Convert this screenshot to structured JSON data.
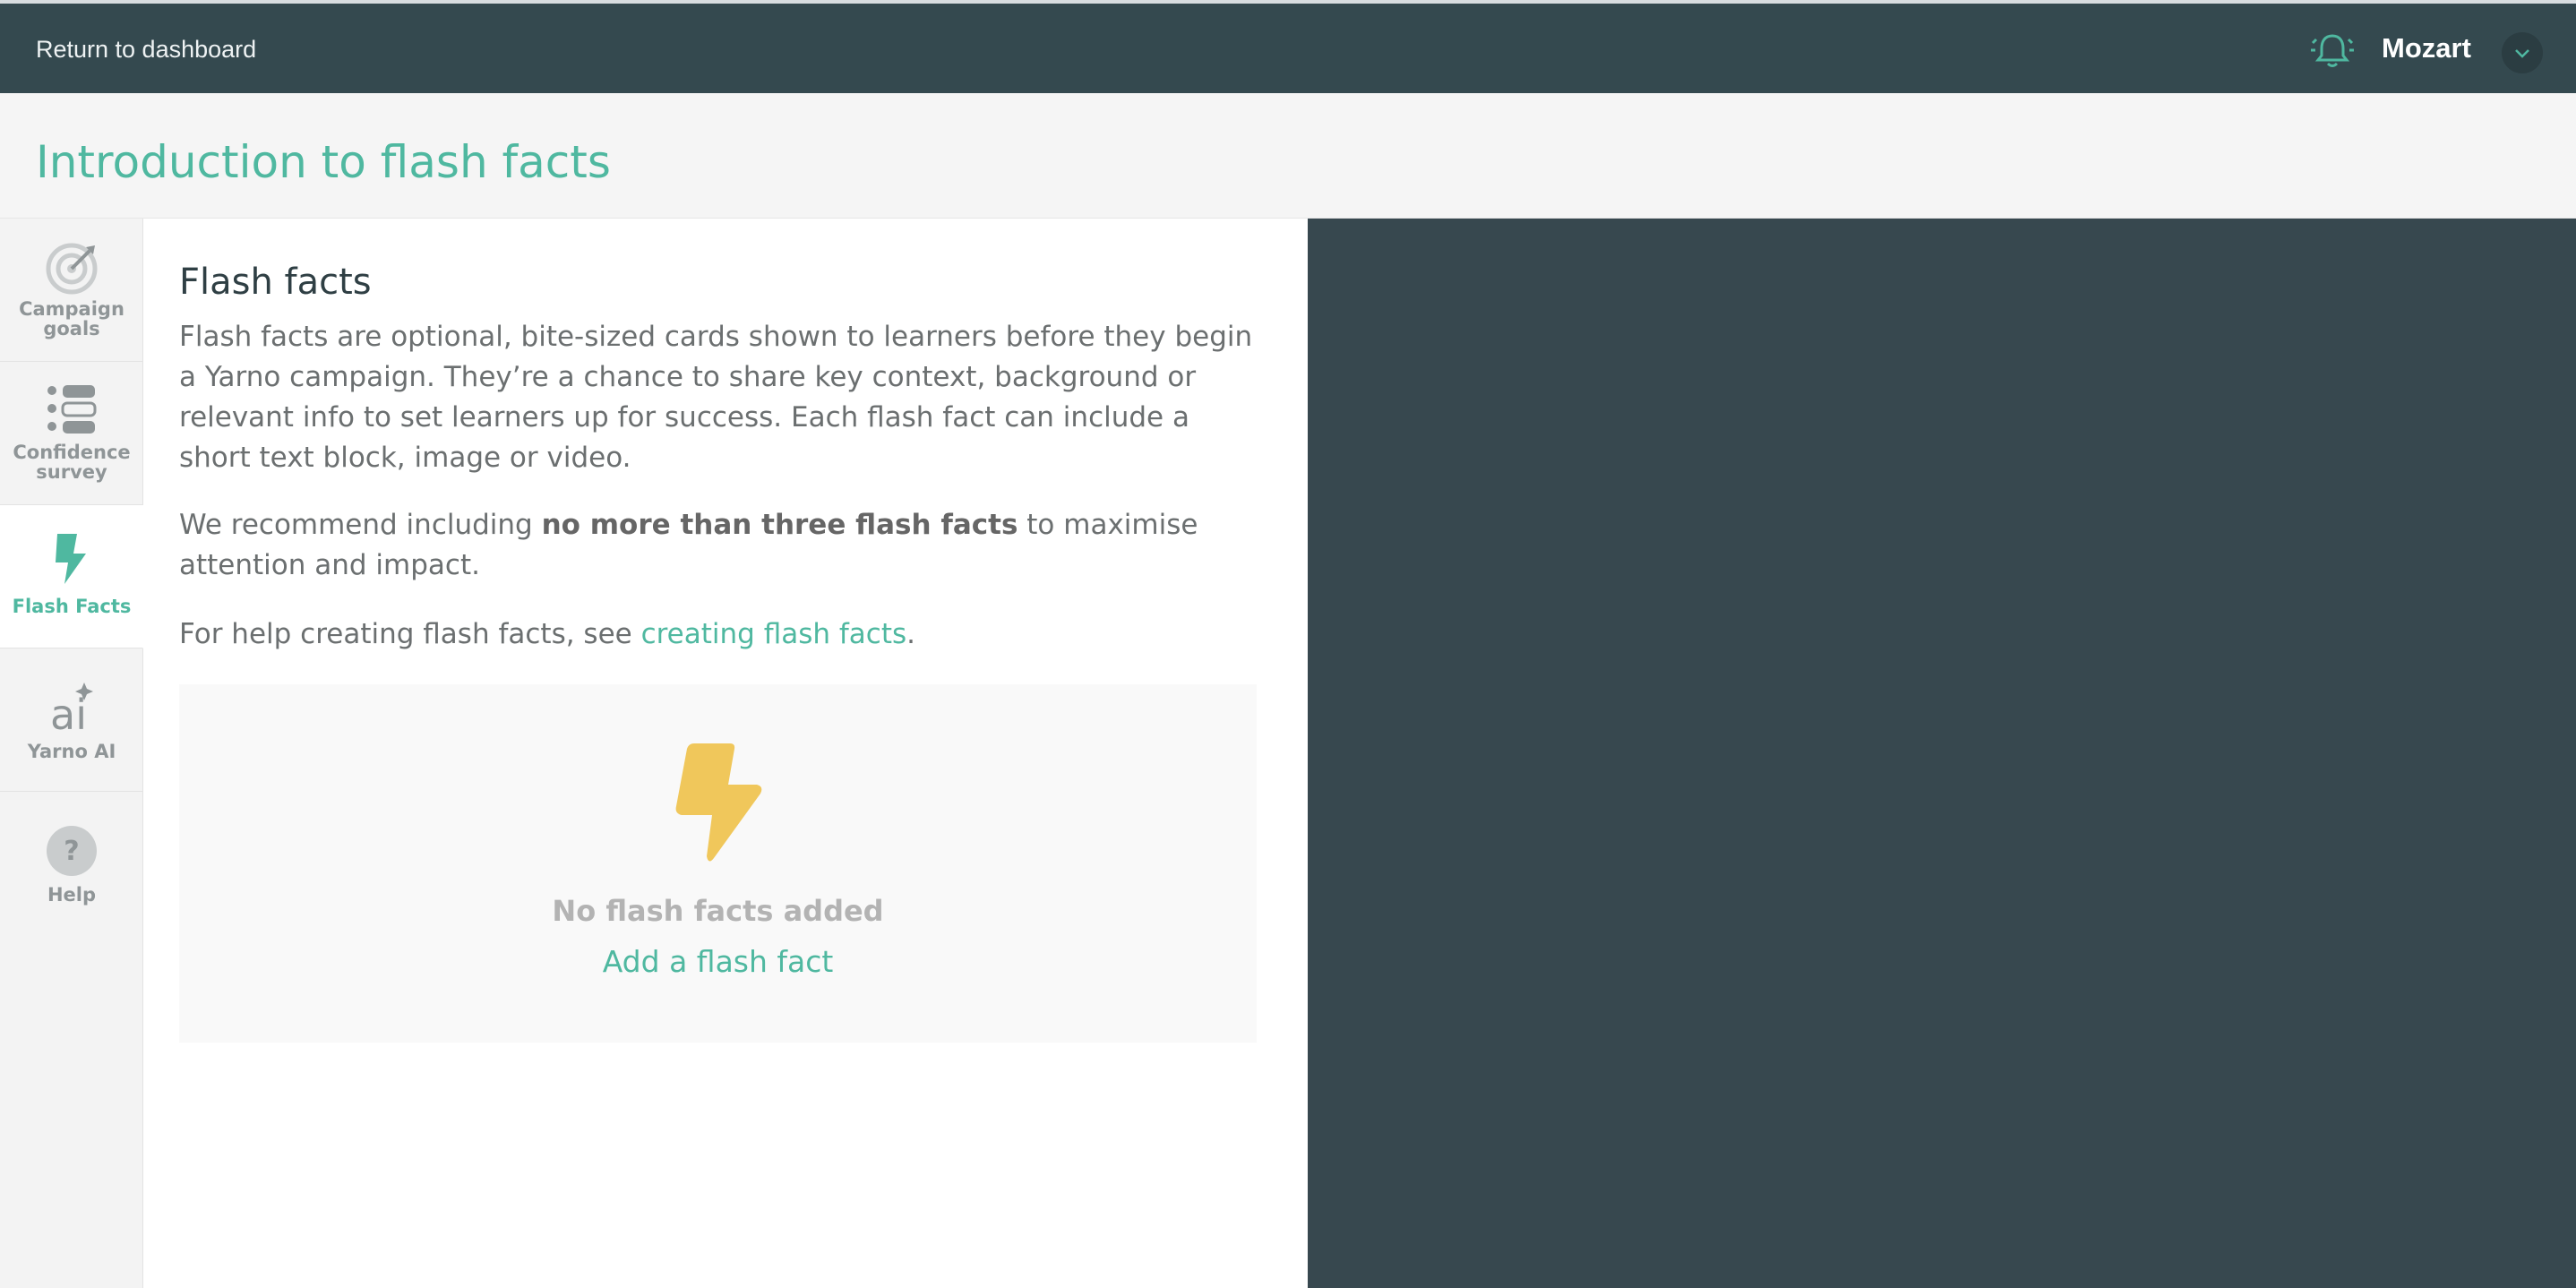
{
  "topbar": {
    "back_label": "Return to dashboard",
    "username": "Mozart",
    "bell_icon": "bell-icon",
    "caret_icon": "chevron-down-icon"
  },
  "page": {
    "title": "Introduction to flash facts"
  },
  "sidebar": {
    "items": [
      {
        "label_line1": "Campaign",
        "label_line2": "goals",
        "icon": "target-icon"
      },
      {
        "label_line1": "Confidence",
        "label_line2": "survey",
        "icon": "list-icon"
      },
      {
        "label_line1": "Flash Facts",
        "icon": "lightning-bolt-icon",
        "active": true
      },
      {
        "label_line1": "Yarno AI",
        "icon": "ai-sparkle-icon"
      },
      {
        "label_line1": "Help",
        "icon": "question-icon"
      }
    ]
  },
  "main": {
    "heading": "Flash facts",
    "intro": "Flash facts are optional, bite-sized cards shown to learners before they begin a Yarno campaign. They’re a chance to share key context, background or relevant info to set learners up for success. Each flash fact can include a short text block, image or video.",
    "recommend_prefix": "We recommend including ",
    "recommend_bold": "no more than three flash facts",
    "recommend_suffix": " to maximise attention and impact.",
    "help_prefix": "For help creating flash facts, see ",
    "help_link": "creating flash facts",
    "help_suffix": ".",
    "empty_state": {
      "title": "No flash facts added",
      "add_label": "Add a flash fact"
    }
  },
  "colors": {
    "accent": "#4fb8a0",
    "topbar": "#34494f",
    "preview": "#37484f",
    "bolt": "#f0c75b"
  }
}
